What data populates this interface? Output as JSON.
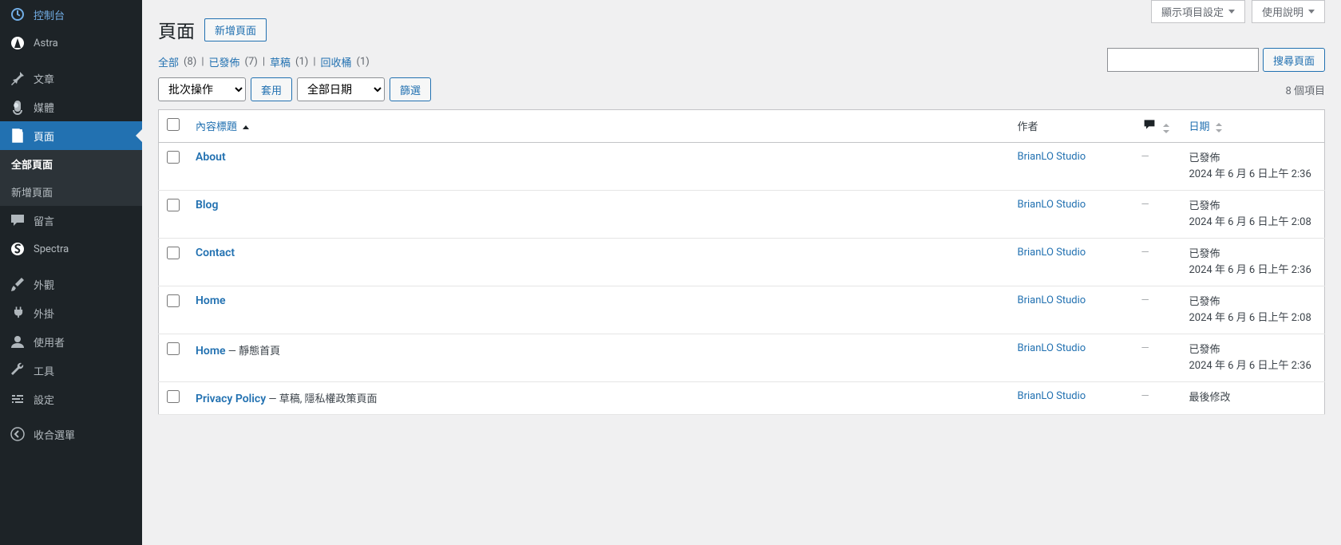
{
  "topButtons": {
    "screenOptions": "顯示項目設定",
    "help": "使用說明"
  },
  "sidebar": {
    "items": [
      {
        "label": "控制台"
      },
      {
        "label": "Astra"
      },
      {
        "label": "文章"
      },
      {
        "label": "媒體"
      },
      {
        "label": "頁面"
      },
      {
        "label": "留言"
      },
      {
        "label": "Spectra"
      },
      {
        "label": "外觀"
      },
      {
        "label": "外掛"
      },
      {
        "label": "使用者"
      },
      {
        "label": "工具"
      },
      {
        "label": "設定"
      },
      {
        "label": "收合選單"
      }
    ],
    "submenu": {
      "all": "全部頁面",
      "new": "新增頁面"
    }
  },
  "header": {
    "title": "頁面",
    "addNew": "新增頁面"
  },
  "filterLinks": {
    "all": "全部",
    "allCount": "(8)",
    "published": "已發佈",
    "publishedCount": "(7)",
    "draft": "草稿",
    "draftCount": "(1)",
    "trash": "回收桶",
    "trashCount": "(1)",
    "sep": " | "
  },
  "search": {
    "button": "搜尋頁面"
  },
  "bulk": {
    "action": "批次操作",
    "apply": "套用",
    "allDates": "全部日期",
    "filter": "篩選",
    "itemCount": "8 個項目"
  },
  "tableHeaders": {
    "title": "內容標題",
    "author": "作者",
    "date": "日期"
  },
  "rows": [
    {
      "title": "About",
      "extra": "",
      "author": "BrianLO Studio",
      "comments": "—",
      "status": "已發佈",
      "date": "2024 年 6 月 6 日上午 2:36"
    },
    {
      "title": "Blog",
      "extra": "",
      "author": "BrianLO Studio",
      "comments": "—",
      "status": "已發佈",
      "date": "2024 年 6 月 6 日上午 2:08"
    },
    {
      "title": "Contact",
      "extra": "",
      "author": "BrianLO Studio",
      "comments": "—",
      "status": "已發佈",
      "date": "2024 年 6 月 6 日上午 2:36"
    },
    {
      "title": "Home",
      "extra": "",
      "author": "BrianLO Studio",
      "comments": "—",
      "status": "已發佈",
      "date": "2024 年 6 月 6 日上午 2:08"
    },
    {
      "title": "Home",
      "extra": " — 靜態首頁",
      "author": "BrianLO Studio",
      "comments": "—",
      "status": "已發佈",
      "date": "2024 年 6 月 6 日上午 2:36"
    },
    {
      "title": "Privacy Policy",
      "extra": " — 草稿, 隱私權政策頁面",
      "author": "BrianLO Studio",
      "comments": "—",
      "status": "最後修改",
      "date": ""
    }
  ]
}
